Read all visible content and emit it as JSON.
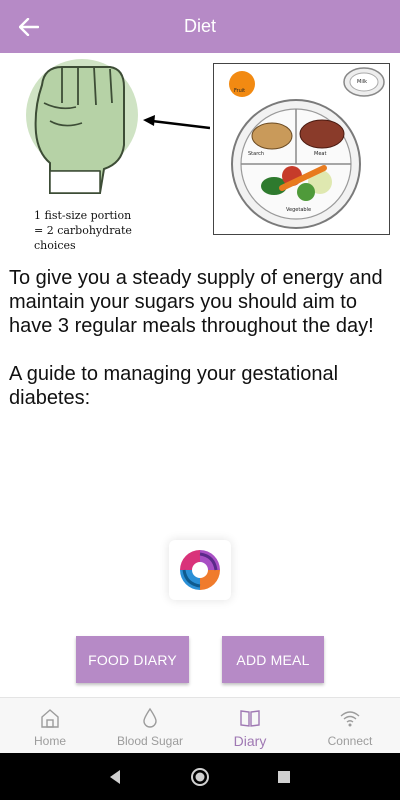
{
  "header": {
    "title": "Diet",
    "back_icon": "arrow-left-icon",
    "background": "#b68ac6"
  },
  "illustration": {
    "fist_caption": [
      "1 fist-size portion",
      "= 2 carbohydrate",
      "choices"
    ],
    "plate_labels": {
      "fruit": "Fruit",
      "milk": "Milk",
      "starch": "Starch",
      "meat": "Meat",
      "vegetable": "Vegetable"
    }
  },
  "content": {
    "paragraph1": "To give you a steady supply of energy and maintain your sugars you should aim to have 3 regular meals throughout the day!",
    "paragraph2": "A guide to managing your gestational diabetes:"
  },
  "buttons": {
    "food_diary": "FOOD DIARY",
    "add_meal": "ADD MEAL"
  },
  "bottom_nav": {
    "items": [
      {
        "label": "Home",
        "icon": "home-icon",
        "active": false
      },
      {
        "label": "Blood Sugar",
        "icon": "drop-icon",
        "active": false
      },
      {
        "label": "Diary",
        "icon": "book-icon",
        "active": true
      },
      {
        "label": "Connect",
        "icon": "wifi-icon",
        "active": false
      }
    ]
  },
  "system_nav": {
    "icons": [
      "back-triangle-icon",
      "home-circle-icon",
      "recents-square-icon"
    ]
  },
  "colors": {
    "accent": "#b68ac6",
    "active_nav": "#9f78b3",
    "inactive_nav": "#9c9c9c"
  }
}
